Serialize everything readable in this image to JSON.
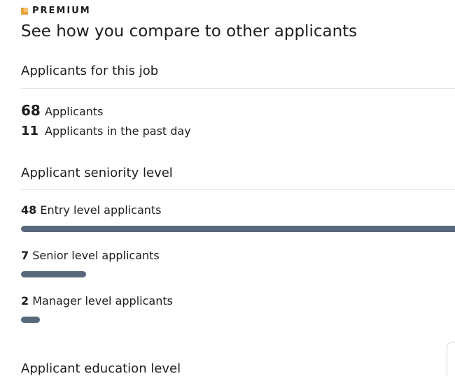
{
  "header": {
    "premium_label": "PREMIUM",
    "title": "See how you compare to other applicants"
  },
  "applicants": {
    "section_title": "Applicants for this job",
    "total_count": "68",
    "total_label": "Applicants",
    "past_day_count": "11",
    "past_day_label": "Applicants in the past day"
  },
  "seniority": {
    "section_title": "Applicant seniority level",
    "levels": [
      {
        "count": "48",
        "label": "Entry level applicants",
        "fraction": 1.0
      },
      {
        "count": "7",
        "label": "Senior level applicants",
        "fraction": 0.146
      },
      {
        "count": "2",
        "label": "Manager level applicants",
        "fraction": 0.042
      }
    ]
  },
  "education": {
    "section_title": "Applicant education level"
  },
  "colors": {
    "bar": "#56687a",
    "premium": "#e7a33e"
  }
}
